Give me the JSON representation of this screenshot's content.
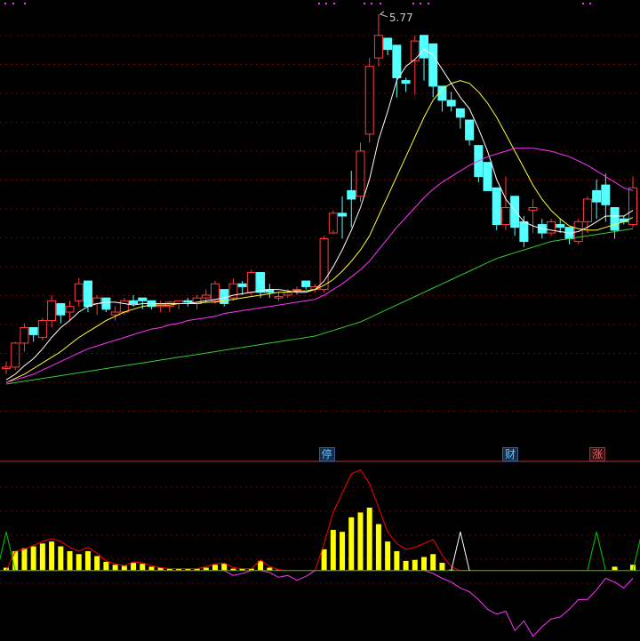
{
  "colors": {
    "background": "#000000",
    "up_candle": "#ff3c3c",
    "down_candle": "#54ffff",
    "ma_white": "#ffffff",
    "ma_yellow": "#ffff33",
    "ma_magenta": "#ff33ff",
    "ma_green": "#33cc33",
    "grid": "#7a0000",
    "divider": "#bb3333",
    "volume_bar": "#ffff00",
    "oscillator_red": "#ff0000",
    "oscillator_green": "#00cc00",
    "oscillator_magenta": "#ff33ff",
    "oscillator_white": "#ffffff",
    "peak_label": "#cccccc",
    "tag_ting": "#55ccff",
    "tag_cai": "#55ccff",
    "tag_zhang": "#ff5555",
    "dots": "#ff33ff"
  },
  "chart_data": [
    {
      "type": "candlestick",
      "title": "",
      "peak_label": "5.77",
      "ylim": [
        3.15,
        5.82
      ],
      "grid": "dashed-horizontal",
      "candles": [
        [
          3.26,
          3.31,
          3.22,
          3.27
        ],
        [
          3.27,
          3.45,
          3.25,
          3.44
        ],
        [
          3.44,
          3.58,
          3.38,
          3.55
        ],
        [
          3.55,
          3.52,
          3.45,
          3.5
        ],
        [
          3.48,
          3.62,
          3.46,
          3.6
        ],
        [
          3.6,
          3.78,
          3.55,
          3.74
        ],
        [
          3.72,
          3.7,
          3.58,
          3.64
        ],
        [
          3.66,
          3.74,
          3.6,
          3.7
        ],
        [
          3.74,
          3.9,
          3.7,
          3.86
        ],
        [
          3.88,
          3.74,
          3.66,
          3.7
        ],
        [
          3.72,
          3.78,
          3.64,
          3.76
        ],
        [
          3.76,
          3.68,
          3.66,
          3.68
        ],
        [
          3.64,
          3.7,
          3.6,
          3.66
        ],
        [
          3.66,
          3.76,
          3.64,
          3.74
        ],
        [
          3.74,
          3.78,
          3.7,
          3.72
        ],
        [
          3.76,
          3.74,
          3.68,
          3.74
        ],
        [
          3.74,
          3.72,
          3.68,
          3.7
        ],
        [
          3.7,
          3.74,
          3.66,
          3.71
        ],
        [
          3.7,
          3.74,
          3.66,
          3.73
        ],
        [
          3.72,
          3.74,
          3.68,
          3.74
        ],
        [
          3.74,
          3.76,
          3.7,
          3.73
        ],
        [
          3.72,
          3.78,
          3.68,
          3.76
        ],
        [
          3.76,
          3.82,
          3.72,
          3.78
        ],
        [
          3.74,
          3.88,
          3.72,
          3.86
        ],
        [
          3.82,
          3.72,
          3.7,
          3.72
        ],
        [
          3.76,
          3.9,
          3.74,
          3.86
        ],
        [
          3.86,
          3.88,
          3.78,
          3.84
        ],
        [
          3.8,
          3.96,
          3.78,
          3.94
        ],
        [
          3.94,
          3.82,
          3.76,
          3.8
        ],
        [
          3.82,
          3.86,
          3.76,
          3.8
        ],
        [
          3.76,
          3.8,
          3.74,
          3.77
        ],
        [
          3.78,
          3.82,
          3.76,
          3.8
        ],
        [
          3.82,
          3.84,
          3.78,
          3.82
        ],
        [
          3.88,
          3.86,
          3.82,
          3.84
        ],
        [
          3.82,
          3.86,
          3.8,
          3.84
        ],
        [
          3.82,
          4.2,
          3.8,
          4.18
        ],
        [
          4.22,
          4.38,
          4.24,
          4.36
        ],
        [
          4.36,
          4.48,
          4.18,
          4.34
        ],
        [
          4.52,
          4.66,
          4.26,
          4.46
        ],
        [
          4.48,
          4.86,
          4.44,
          4.8
        ],
        [
          4.92,
          5.46,
          4.86,
          5.4
        ],
        [
          5.46,
          5.77,
          5.4,
          5.62
        ],
        [
          5.6,
          5.52,
          5.48,
          5.52
        ],
        [
          5.55,
          5.4,
          5.18,
          5.32
        ],
        [
          5.3,
          5.32,
          5.22,
          5.28
        ],
        [
          5.44,
          5.62,
          5.2,
          5.58
        ],
        [
          5.62,
          5.6,
          5.3,
          5.46
        ],
        [
          5.56,
          5.38,
          5.18,
          5.26
        ],
        [
          5.26,
          5.2,
          5.08,
          5.16
        ],
        [
          5.16,
          5.22,
          5.08,
          5.12
        ],
        [
          5.1,
          5.08,
          4.96,
          5.04
        ],
        [
          5.02,
          5.0,
          4.84,
          4.88
        ],
        [
          4.84,
          4.7,
          4.58,
          4.62
        ],
        [
          4.72,
          4.6,
          4.54,
          4.52
        ],
        [
          4.54,
          4.52,
          4.24,
          4.28
        ],
        [
          4.28,
          4.62,
          4.24,
          4.4
        ],
        [
          4.48,
          4.38,
          4.2,
          4.26
        ],
        [
          4.3,
          4.34,
          4.12,
          4.16
        ],
        [
          4.38,
          4.46,
          4.22,
          4.4
        ],
        [
          4.28,
          4.32,
          4.18,
          4.22
        ],
        [
          4.22,
          4.32,
          4.2,
          4.3
        ],
        [
          4.28,
          4.32,
          4.22,
          4.26
        ],
        [
          4.26,
          4.24,
          4.14,
          4.18
        ],
        [
          4.16,
          4.32,
          4.14,
          4.3
        ],
        [
          4.3,
          4.48,
          4.22,
          4.46
        ],
        [
          4.52,
          4.6,
          4.32,
          4.44
        ],
        [
          4.56,
          4.64,
          4.3,
          4.42
        ],
        [
          4.4,
          4.32,
          4.18,
          4.24
        ],
        [
          4.32,
          4.34,
          4.28,
          4.3
        ],
        [
          4.28,
          4.62,
          4.26,
          4.54
        ]
      ],
      "ma_series": [
        {
          "color_key": "ma_white",
          "values": [
            3.18,
            3.22,
            3.28,
            3.33,
            3.4,
            3.48,
            3.55,
            3.6,
            3.66,
            3.7,
            3.72,
            3.73,
            3.73,
            3.72,
            3.71,
            3.72,
            3.72,
            3.72,
            3.72,
            3.72,
            3.72,
            3.73,
            3.74,
            3.75,
            3.76,
            3.78,
            3.79,
            3.8,
            3.81,
            3.82,
            3.82,
            3.81,
            3.8,
            3.8,
            3.82,
            3.88,
            3.98,
            4.1,
            4.24,
            4.4,
            4.6,
            4.88,
            5.08,
            5.3,
            5.4,
            5.45,
            5.52,
            5.48,
            5.38,
            5.28,
            5.18,
            5.1,
            4.96,
            4.8,
            4.6,
            4.46,
            4.38,
            4.3,
            4.27,
            4.25,
            4.24,
            4.23,
            4.22,
            4.23,
            4.26,
            4.3,
            4.34,
            4.34,
            4.34,
            4.38
          ]
        },
        {
          "color_key": "ma_yellow",
          "values": [
            3.16,
            3.19,
            3.22,
            3.26,
            3.3,
            3.34,
            3.38,
            3.43,
            3.48,
            3.52,
            3.56,
            3.6,
            3.63,
            3.66,
            3.68,
            3.7,
            3.71,
            3.71,
            3.71,
            3.72,
            3.72,
            3.72,
            3.73,
            3.73,
            3.74,
            3.75,
            3.76,
            3.77,
            3.78,
            3.79,
            3.8,
            3.8,
            3.81,
            3.81,
            3.82,
            3.85,
            3.89,
            3.95,
            4.02,
            4.1,
            4.2,
            4.34,
            4.48,
            4.62,
            4.76,
            4.9,
            5.04,
            5.16,
            5.24,
            5.28,
            5.3,
            5.28,
            5.22,
            5.14,
            5.04,
            4.92,
            4.8,
            4.68,
            4.56,
            4.46,
            4.38,
            4.32,
            4.27,
            4.25,
            4.24,
            4.24,
            4.26,
            4.28,
            4.3,
            4.33
          ]
        },
        {
          "color_key": "ma_magenta",
          "values": [
            3.16,
            3.18,
            3.2,
            3.22,
            3.25,
            3.28,
            3.31,
            3.34,
            3.37,
            3.4,
            3.42,
            3.44,
            3.46,
            3.48,
            3.5,
            3.52,
            3.54,
            3.55,
            3.57,
            3.58,
            3.6,
            3.61,
            3.62,
            3.63,
            3.65,
            3.66,
            3.67,
            3.68,
            3.69,
            3.7,
            3.71,
            3.72,
            3.73,
            3.74,
            3.75,
            3.78,
            3.82,
            3.86,
            3.91,
            3.96,
            4.02,
            4.1,
            4.18,
            4.26,
            4.33,
            4.4,
            4.47,
            4.53,
            4.58,
            4.62,
            4.66,
            4.7,
            4.73,
            4.76,
            4.78,
            4.8,
            4.82,
            4.82,
            4.82,
            4.81,
            4.8,
            4.78,
            4.76,
            4.73,
            4.7,
            4.66,
            4.62,
            4.58,
            4.54,
            4.52
          ]
        },
        {
          "color_key": "ma_green",
          "values": [
            3.15,
            3.16,
            3.17,
            3.18,
            3.19,
            3.2,
            3.21,
            3.22,
            3.23,
            3.24,
            3.25,
            3.26,
            3.27,
            3.28,
            3.29,
            3.3,
            3.31,
            3.32,
            3.33,
            3.34,
            3.35,
            3.36,
            3.37,
            3.38,
            3.39,
            3.4,
            3.41,
            3.42,
            3.43,
            3.44,
            3.45,
            3.46,
            3.47,
            3.48,
            3.49,
            3.51,
            3.53,
            3.55,
            3.57,
            3.59,
            3.62,
            3.65,
            3.68,
            3.71,
            3.74,
            3.77,
            3.8,
            3.83,
            3.86,
            3.89,
            3.92,
            3.95,
            3.98,
            4.01,
            4.04,
            4.06,
            4.08,
            4.1,
            4.12,
            4.14,
            4.16,
            4.17,
            4.18,
            4.19,
            4.2,
            4.21,
            4.22,
            4.23,
            4.24,
            4.25
          ]
        }
      ]
    },
    {
      "type": "indicator",
      "ylim": [
        -70,
        110
      ],
      "baseline": 0,
      "bars": [
        3,
        20,
        23,
        25,
        28,
        30,
        25,
        20,
        17,
        20,
        15,
        9,
        6,
        5,
        8,
        7,
        4,
        3,
        2,
        2,
        2,
        2,
        3,
        6,
        7,
        2,
        2,
        2,
        10,
        3,
        1,
        0,
        0,
        0,
        0,
        22,
        42,
        40,
        55,
        60,
        65,
        48,
        30,
        20,
        10,
        11,
        14,
        17,
        8,
        1,
        0,
        0,
        0,
        0,
        0,
        0,
        0,
        0,
        0,
        0,
        0,
        0,
        0,
        0,
        0,
        0,
        0,
        4,
        0,
        6
      ],
      "red_line": [
        0,
        20,
        22,
        26,
        30,
        33,
        30,
        24,
        20,
        24,
        18,
        10,
        7,
        5,
        9,
        8,
        5,
        3,
        2,
        2,
        2,
        2,
        4,
        7,
        8,
        3,
        2,
        2,
        11,
        4,
        1,
        0,
        0,
        0,
        0,
        28,
        60,
        80,
        100,
        104,
        90,
        65,
        40,
        28,
        22,
        24,
        28,
        32,
        16,
        4,
        0,
        0,
        0,
        0,
        0,
        0,
        0,
        0,
        0,
        0,
        0,
        0,
        0,
        0,
        0,
        0,
        0,
        0,
        0,
        0
      ],
      "magenta_line": [
        0,
        0,
        0,
        0,
        0,
        0,
        0,
        0,
        0,
        0,
        0,
        0,
        0,
        0,
        0,
        0,
        0,
        0,
        0,
        0,
        0,
        0,
        0,
        0,
        0,
        -5,
        -3,
        0,
        0,
        -2,
        -7,
        -5,
        -10,
        -6,
        0,
        0,
        0,
        0,
        0,
        0,
        0,
        0,
        0,
        0,
        0,
        0,
        0,
        -3,
        -8,
        -12,
        -18,
        -22,
        -30,
        -40,
        -45,
        -42,
        -62,
        -52,
        -68,
        -58,
        -50,
        -48,
        -40,
        -30,
        -30,
        -20,
        -8,
        -12,
        -18,
        -8
      ],
      "green_spikes": [
        [
          -1,
          0
        ],
        [
          0,
          40
        ],
        [
          1,
          0
        ],
        [
          64,
          0
        ],
        [
          65,
          40
        ],
        [
          66,
          0
        ],
        [
          69,
          0
        ],
        [
          70,
          40
        ]
      ],
      "white_spikes": [
        [
          49,
          0
        ],
        [
          50,
          40
        ],
        [
          51,
          0
        ]
      ]
    }
  ],
  "event_tags": [
    {
      "text": "停",
      "index": 35.2,
      "color_key": "tag_ting"
    },
    {
      "text": "财",
      "index": 55.4,
      "color_key": "tag_cai"
    },
    {
      "text": "涨",
      "index": 65.0,
      "color_key": "tag_zhang"
    }
  ]
}
